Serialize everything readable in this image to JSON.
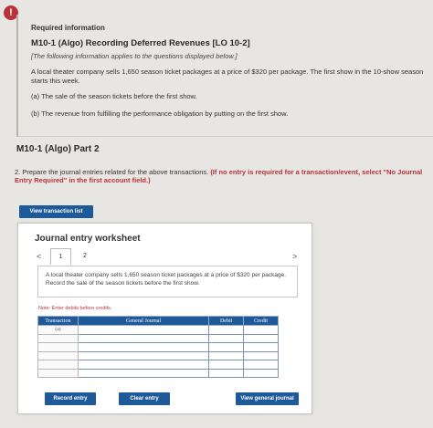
{
  "alert": {
    "glyph": "!"
  },
  "requirement": {
    "heading": "Required information",
    "title": "M10-1 (Algo) Recording Deferred Revenues [LO 10-2]",
    "note": "[The following information applies to the questions displayed below.]",
    "text": "A local theater company sells 1,650 season ticket packages at a price of $320 per package. The first show in the 10-show season starts this week.",
    "item_a": "(a) The sale of the season tickets before the first show.",
    "item_b": "(b) The revenue from fulfilling the performance obligation by putting on the first show."
  },
  "part": {
    "title": "M10-1 (Algo) Part 2",
    "instruction_prefix": "2. Prepare the journal entries related for the above transactions.",
    "instruction_red": "(If no entry is required for a transaction/event, select \"No Journal Entry Required\" in the first account field.)"
  },
  "buttons": {
    "view_transaction_list": "View transaction list",
    "record_entry": "Record entry",
    "clear_entry": "Clear entry",
    "view_general_journal": "View general journal"
  },
  "worksheet": {
    "title": "Journal entry worksheet",
    "nav_prev": "<",
    "nav_next": ">",
    "pages": [
      "1",
      "2"
    ],
    "description": "A local theater company sells 1,650 season ticket packages at a price of $320 per package. Record the sale of the season tickets before the first show.",
    "note": "Note: Enter debits before credits.",
    "columns": [
      "Transaction",
      "General Journal",
      "Debit",
      "Credit"
    ],
    "rows": [
      {
        "transaction": "(a)"
      },
      {
        "transaction": ""
      },
      {
        "transaction": ""
      },
      {
        "transaction": ""
      },
      {
        "transaction": ""
      },
      {
        "transaction": ""
      }
    ]
  },
  "colors": {
    "brand_blue": "#1e5a9a",
    "alert_red": "#b8323a"
  }
}
